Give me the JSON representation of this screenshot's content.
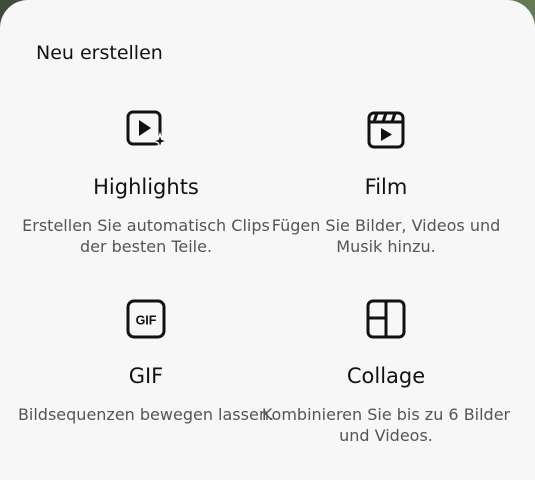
{
  "sheet": {
    "title": "Neu erstellen"
  },
  "options": [
    {
      "icon": "highlights-video-icon",
      "label": "Highlights",
      "description": "Erstellen Sie automatisch Clips der besten Teile."
    },
    {
      "icon": "film-clapper-icon",
      "label": "Film",
      "description": "Fügen Sie Bilder, Videos und Musik hinzu."
    },
    {
      "icon": "gif-icon",
      "label": "GIF",
      "description": "Bildsequenzen bewegen lassen."
    },
    {
      "icon": "collage-layout-icon",
      "label": "Collage",
      "description": "Kombinieren Sie bis zu 6 Bilder und Videos."
    }
  ],
  "colors": {
    "sheet_background": "#f7f7f7",
    "text_primary": "#111111",
    "text_secondary": "#555555"
  }
}
